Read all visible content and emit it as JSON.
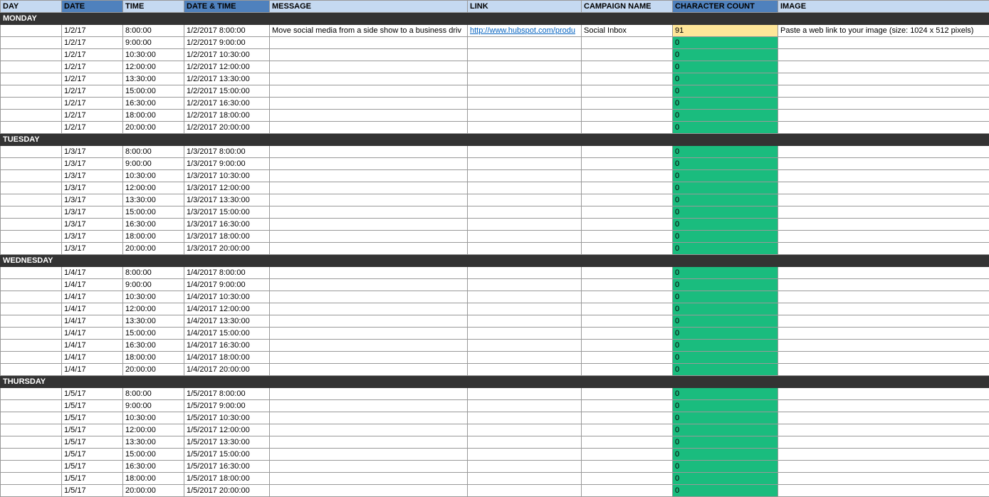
{
  "headers": [
    {
      "label": "DAY",
      "cls": "h-light"
    },
    {
      "label": "DATE",
      "cls": "h-dark"
    },
    {
      "label": "TIME",
      "cls": "h-light"
    },
    {
      "label": "DATE & TIME",
      "cls": "h-dark"
    },
    {
      "label": "MESSAGE",
      "cls": "h-light"
    },
    {
      "label": "LINK",
      "cls": "h-light"
    },
    {
      "label": "CAMPAIGN NAME",
      "cls": "h-light"
    },
    {
      "label": "CHARACTER COUNT",
      "cls": "h-dark"
    },
    {
      "label": "IMAGE",
      "cls": "h-light"
    }
  ],
  "days": [
    {
      "name": "MONDAY",
      "rows": [
        {
          "date": "1/2/17",
          "time": "8:00:00",
          "dt": "1/2/2017 8:00:00",
          "msg": "Move social media from a side show to a business driv",
          "link": "http://www.hubspot.com/produ",
          "camp": "Social Inbox",
          "cc": "91",
          "ccCls": "cc-yellow",
          "img": "Paste a web link to your image (size: 1024 x 512 pixels)"
        },
        {
          "date": "1/2/17",
          "time": "9:00:00",
          "dt": "1/2/2017 9:00:00",
          "cc": "0",
          "ccCls": "cc-green"
        },
        {
          "date": "1/2/17",
          "time": "10:30:00",
          "dt": "1/2/2017 10:30:00",
          "cc": "0",
          "ccCls": "cc-green"
        },
        {
          "date": "1/2/17",
          "time": "12:00:00",
          "dt": "1/2/2017 12:00:00",
          "cc": "0",
          "ccCls": "cc-green"
        },
        {
          "date": "1/2/17",
          "time": "13:30:00",
          "dt": "1/2/2017 13:30:00",
          "cc": "0",
          "ccCls": "cc-green"
        },
        {
          "date": "1/2/17",
          "time": "15:00:00",
          "dt": "1/2/2017 15:00:00",
          "cc": "0",
          "ccCls": "cc-green"
        },
        {
          "date": "1/2/17",
          "time": "16:30:00",
          "dt": "1/2/2017 16:30:00",
          "cc": "0",
          "ccCls": "cc-green"
        },
        {
          "date": "1/2/17",
          "time": "18:00:00",
          "dt": "1/2/2017 18:00:00",
          "cc": "0",
          "ccCls": "cc-green"
        },
        {
          "date": "1/2/17",
          "time": "20:00:00",
          "dt": "1/2/2017 20:00:00",
          "cc": "0",
          "ccCls": "cc-green"
        }
      ]
    },
    {
      "name": "TUESDAY",
      "rows": [
        {
          "date": "1/3/17",
          "time": "8:00:00",
          "dt": "1/3/2017 8:00:00",
          "cc": "0",
          "ccCls": "cc-green"
        },
        {
          "date": "1/3/17",
          "time": "9:00:00",
          "dt": "1/3/2017 9:00:00",
          "cc": "0",
          "ccCls": "cc-green"
        },
        {
          "date": "1/3/17",
          "time": "10:30:00",
          "dt": "1/3/2017 10:30:00",
          "cc": "0",
          "ccCls": "cc-green"
        },
        {
          "date": "1/3/17",
          "time": "12:00:00",
          "dt": "1/3/2017 12:00:00",
          "cc": "0",
          "ccCls": "cc-green"
        },
        {
          "date": "1/3/17",
          "time": "13:30:00",
          "dt": "1/3/2017 13:30:00",
          "cc": "0",
          "ccCls": "cc-green"
        },
        {
          "date": "1/3/17",
          "time": "15:00:00",
          "dt": "1/3/2017 15:00:00",
          "cc": "0",
          "ccCls": "cc-green"
        },
        {
          "date": "1/3/17",
          "time": "16:30:00",
          "dt": "1/3/2017 16:30:00",
          "cc": "0",
          "ccCls": "cc-green"
        },
        {
          "date": "1/3/17",
          "time": "18:00:00",
          "dt": "1/3/2017 18:00:00",
          "cc": "0",
          "ccCls": "cc-green"
        },
        {
          "date": "1/3/17",
          "time": "20:00:00",
          "dt": "1/3/2017 20:00:00",
          "cc": "0",
          "ccCls": "cc-green"
        }
      ]
    },
    {
      "name": "WEDNESDAY",
      "rows": [
        {
          "date": "1/4/17",
          "time": "8:00:00",
          "dt": "1/4/2017 8:00:00",
          "cc": "0",
          "ccCls": "cc-green"
        },
        {
          "date": "1/4/17",
          "time": "9:00:00",
          "dt": "1/4/2017 9:00:00",
          "cc": "0",
          "ccCls": "cc-green"
        },
        {
          "date": "1/4/17",
          "time": "10:30:00",
          "dt": "1/4/2017 10:30:00",
          "cc": "0",
          "ccCls": "cc-green"
        },
        {
          "date": "1/4/17",
          "time": "12:00:00",
          "dt": "1/4/2017 12:00:00",
          "cc": "0",
          "ccCls": "cc-green"
        },
        {
          "date": "1/4/17",
          "time": "13:30:00",
          "dt": "1/4/2017 13:30:00",
          "cc": "0",
          "ccCls": "cc-green"
        },
        {
          "date": "1/4/17",
          "time": "15:00:00",
          "dt": "1/4/2017 15:00:00",
          "cc": "0",
          "ccCls": "cc-green"
        },
        {
          "date": "1/4/17",
          "time": "16:30:00",
          "dt": "1/4/2017 16:30:00",
          "cc": "0",
          "ccCls": "cc-green"
        },
        {
          "date": "1/4/17",
          "time": "18:00:00",
          "dt": "1/4/2017 18:00:00",
          "cc": "0",
          "ccCls": "cc-green"
        },
        {
          "date": "1/4/17",
          "time": "20:00:00",
          "dt": "1/4/2017 20:00:00",
          "cc": "0",
          "ccCls": "cc-green"
        }
      ]
    },
    {
      "name": "THURSDAY",
      "rows": [
        {
          "date": "1/5/17",
          "time": "8:00:00",
          "dt": "1/5/2017 8:00:00",
          "cc": "0",
          "ccCls": "cc-green"
        },
        {
          "date": "1/5/17",
          "time": "9:00:00",
          "dt": "1/5/2017 9:00:00",
          "cc": "0",
          "ccCls": "cc-green"
        },
        {
          "date": "1/5/17",
          "time": "10:30:00",
          "dt": "1/5/2017 10:30:00",
          "cc": "0",
          "ccCls": "cc-green"
        },
        {
          "date": "1/5/17",
          "time": "12:00:00",
          "dt": "1/5/2017 12:00:00",
          "cc": "0",
          "ccCls": "cc-green"
        },
        {
          "date": "1/5/17",
          "time": "13:30:00",
          "dt": "1/5/2017 13:30:00",
          "cc": "0",
          "ccCls": "cc-green"
        },
        {
          "date": "1/5/17",
          "time": "15:00:00",
          "dt": "1/5/2017 15:00:00",
          "cc": "0",
          "ccCls": "cc-green"
        },
        {
          "date": "1/5/17",
          "time": "16:30:00",
          "dt": "1/5/2017 16:30:00",
          "cc": "0",
          "ccCls": "cc-green"
        },
        {
          "date": "1/5/17",
          "time": "18:00:00",
          "dt": "1/5/2017 18:00:00",
          "cc": "0",
          "ccCls": "cc-green"
        },
        {
          "date": "1/5/17",
          "time": "20:00:00",
          "dt": "1/5/2017 20:00:00",
          "cc": "0",
          "ccCls": "cc-green"
        }
      ]
    }
  ]
}
